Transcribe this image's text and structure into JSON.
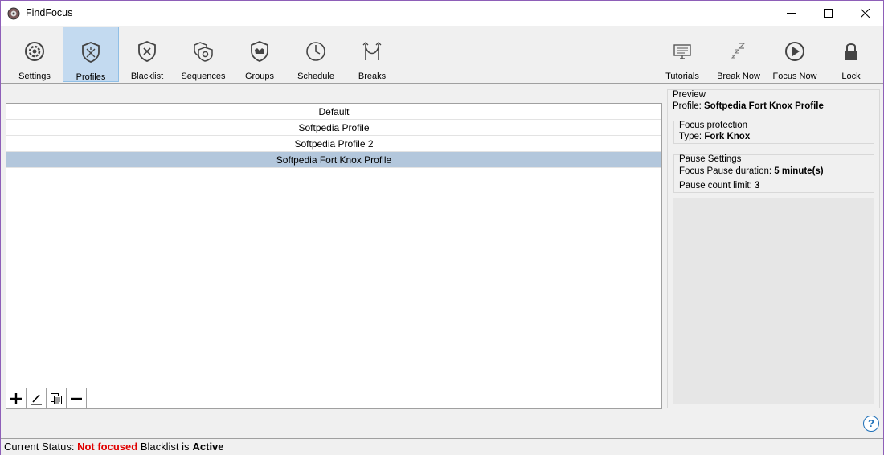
{
  "window": {
    "title": "FindFocus"
  },
  "toolbar": {
    "left": [
      {
        "id": "settings",
        "label": "Settings",
        "icon": "gear-icon"
      },
      {
        "id": "profiles",
        "label": "Profiles",
        "icon": "shield-profile-icon",
        "active": true
      },
      {
        "id": "blacklist",
        "label": "Blacklist",
        "icon": "shield-x-icon"
      },
      {
        "id": "sequences",
        "label": "Sequences",
        "icon": "stacked-shields-icon"
      },
      {
        "id": "groups",
        "label": "Groups",
        "icon": "shield-group-icon"
      },
      {
        "id": "schedule",
        "label": "Schedule",
        "icon": "clock-icon"
      },
      {
        "id": "breaks",
        "label": "Breaks",
        "icon": "hammock-icon"
      }
    ],
    "right": [
      {
        "id": "tutorials",
        "label": "Tutorials",
        "icon": "monitor-icon"
      },
      {
        "id": "break-now",
        "label": "Break Now",
        "icon": "sleep-zz-icon"
      },
      {
        "id": "focus-now",
        "label": "Focus Now",
        "icon": "play-circle-icon"
      },
      {
        "id": "lock",
        "label": "Lock",
        "icon": "padlock-icon"
      }
    ]
  },
  "profiles": {
    "items": [
      "Default",
      "Softpedia Profile",
      "Softpedia Profile 2",
      "Softpedia Fort Knox Profile"
    ],
    "selected_index": 3
  },
  "preview": {
    "title": "Preview",
    "profile_label": "Profile:",
    "profile_value": "Softpedia Fort Knox Profile",
    "focus_protection": {
      "title": "Focus protection",
      "type_label": "Type:",
      "type_value": "Fork Knox"
    },
    "pause_settings": {
      "title": "Pause Settings",
      "duration_label": "Focus Pause duration:",
      "duration_value": "5 minute(s)",
      "count_label": "Pause count limit:",
      "count_value": "3"
    }
  },
  "help": {
    "label": "?"
  },
  "status": {
    "label": "Current Status:",
    "focus_state": "Not focused",
    "blacklist_label": "Blacklist is",
    "blacklist_state": "Active"
  },
  "colors": {
    "accent_border": "#8e5fb8",
    "active_tool": "#c3daf0",
    "selected_row": "#b3c7dc",
    "status_red": "#e00000"
  }
}
